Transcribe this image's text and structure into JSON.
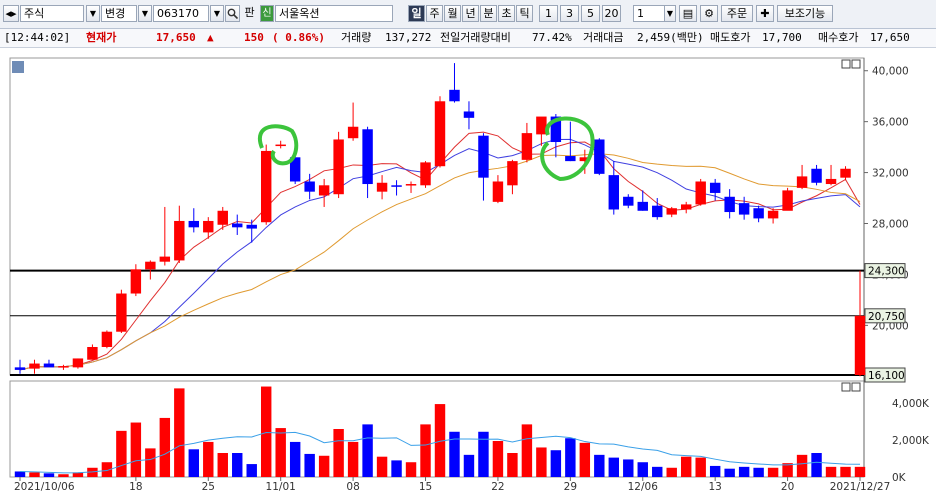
{
  "toolbar": {
    "market_select": "주식",
    "mode_select": "변경",
    "code_input": "063170",
    "pan_button": "판",
    "credit_badge": "신",
    "company_name": "서울옥션",
    "period_buttons": [
      "일",
      "주",
      "월",
      "년",
      "분",
      "초",
      "틱"
    ],
    "active_period": "일",
    "interval_buttons": [
      "1",
      "3",
      "5",
      "20"
    ],
    "interval_value": "1",
    "order_button": "주문",
    "aux_button": "보조기능"
  },
  "info_bar": {
    "time": "[12:44:02]",
    "price_label": "현재가",
    "price": "17,650",
    "change_arrow": "▲",
    "change": "150",
    "change_pct": "( 0.86%)",
    "volume_label": "거래량",
    "volume": "137,272",
    "prev_ratio_label": "전일거래량대비",
    "prev_ratio": "77.42%",
    "trade_value_label": "거래대금",
    "trade_value": "2,459(백만)",
    "ask_label": "매도호가",
    "ask": "17,700",
    "bid_label": "매수호가",
    "bid": "17,650"
  },
  "chart_data": {
    "type": "candlestick",
    "price_axis_ticks": [
      "40,000",
      "36,000",
      "32,000",
      "28,000",
      "24,000",
      "20,000"
    ],
    "volume_axis_ticks": [
      "4,000K",
      "2,000K",
      "0K"
    ],
    "date_axis_ticks": [
      "2021/10/06",
      "18",
      "25",
      "11/01",
      "08",
      "15",
      "22",
      "29",
      "12/06",
      "13",
      "20",
      "2021/12/27"
    ],
    "ylim": [
      16100,
      41000
    ],
    "horizontal_levels": [
      {
        "label": "24,300",
        "value": 24300
      },
      {
        "label": "20,750",
        "value": 20750
      },
      {
        "label": "16,100",
        "value": 16100
      }
    ],
    "candles": [
      {
        "o": 16700,
        "h": 17300,
        "l": 16200,
        "c": 16500,
        "v": 300
      },
      {
        "o": 16600,
        "h": 17300,
        "l": 16200,
        "c": 17000,
        "v": 250
      },
      {
        "o": 17000,
        "h": 17300,
        "l": 16900,
        "c": 16700,
        "v": 200
      },
      {
        "o": 16700,
        "h": 16900,
        "l": 16500,
        "c": 16800,
        "v": 150
      },
      {
        "o": 16700,
        "h": 17400,
        "l": 16600,
        "c": 17400,
        "v": 250
      },
      {
        "o": 17300,
        "h": 18500,
        "l": 17300,
        "c": 18300,
        "v": 500
      },
      {
        "o": 18300,
        "h": 19600,
        "l": 18200,
        "c": 19500,
        "v": 800
      },
      {
        "o": 19500,
        "h": 22800,
        "l": 19400,
        "c": 22500,
        "v": 2500
      },
      {
        "o": 22500,
        "h": 24800,
        "l": 22300,
        "c": 24400,
        "v": 2950
      },
      {
        "o": 24400,
        "h": 25100,
        "l": 23600,
        "c": 25000,
        "v": 1550
      },
      {
        "o": 25000,
        "h": 29300,
        "l": 24700,
        "c": 25400,
        "v": 3200
      },
      {
        "o": 25100,
        "h": 29400,
        "l": 24900,
        "c": 28200,
        "v": 4800
      },
      {
        "o": 28200,
        "h": 29200,
        "l": 27300,
        "c": 27700,
        "v": 1500
      },
      {
        "o": 27300,
        "h": 28500,
        "l": 26800,
        "c": 28200,
        "v": 1900
      },
      {
        "o": 27900,
        "h": 29300,
        "l": 27500,
        "c": 29000,
        "v": 1300
      },
      {
        "o": 28000,
        "h": 28700,
        "l": 27100,
        "c": 27700,
        "v": 1300
      },
      {
        "o": 27900,
        "h": 28300,
        "l": 26500,
        "c": 27600,
        "v": 700
      },
      {
        "o": 28100,
        "h": 34200,
        "l": 27900,
        "c": 33700,
        "v": 4900
      },
      {
        "o": 34100,
        "h": 34500,
        "l": 33900,
        "c": 34200,
        "v": 2650
      },
      {
        "o": 33200,
        "h": 33700,
        "l": 31100,
        "c": 31300,
        "v": 1900
      },
      {
        "o": 31300,
        "h": 31900,
        "l": 29900,
        "c": 30500,
        "v": 1250
      },
      {
        "o": 30200,
        "h": 31500,
        "l": 29300,
        "c": 31000,
        "v": 1150
      },
      {
        "o": 30300,
        "h": 35200,
        "l": 30000,
        "c": 34600,
        "v": 2600
      },
      {
        "o": 34700,
        "h": 37500,
        "l": 34500,
        "c": 35600,
        "v": 1900
      },
      {
        "o": 35400,
        "h": 35600,
        "l": 30000,
        "c": 31100,
        "v": 2850
      },
      {
        "o": 30500,
        "h": 31800,
        "l": 29900,
        "c": 31200,
        "v": 1100
      },
      {
        "o": 31000,
        "h": 31400,
        "l": 30200,
        "c": 30900,
        "v": 900
      },
      {
        "o": 31000,
        "h": 31300,
        "l": 30400,
        "c": 31100,
        "v": 800
      },
      {
        "o": 31000,
        "h": 32900,
        "l": 30800,
        "c": 32800,
        "v": 2850
      },
      {
        "o": 32500,
        "h": 38000,
        "l": 32400,
        "c": 37600,
        "v": 3950
      },
      {
        "o": 38500,
        "h": 40600,
        "l": 37500,
        "c": 37600,
        "v": 2450
      },
      {
        "o": 36800,
        "h": 37600,
        "l": 35400,
        "c": 36300,
        "v": 1200
      },
      {
        "o": 34900,
        "h": 35100,
        "l": 29800,
        "c": 31600,
        "v": 2450
      },
      {
        "o": 29700,
        "h": 31800,
        "l": 29600,
        "c": 31300,
        "v": 1950
      },
      {
        "o": 31000,
        "h": 33000,
        "l": 30300,
        "c": 32900,
        "v": 1300
      },
      {
        "o": 33000,
        "h": 35900,
        "l": 32800,
        "c": 35100,
        "v": 2850
      },
      {
        "o": 35000,
        "h": 36300,
        "l": 34100,
        "c": 36400,
        "v": 1600
      },
      {
        "o": 36400,
        "h": 36600,
        "l": 33200,
        "c": 34400,
        "v": 1450
      },
      {
        "o": 33300,
        "h": 36000,
        "l": 32900,
        "c": 32900,
        "v": 2100
      },
      {
        "o": 32900,
        "h": 33800,
        "l": 31900,
        "c": 33200,
        "v": 1850
      },
      {
        "o": 34600,
        "h": 34700,
        "l": 31800,
        "c": 31900,
        "v": 1200
      },
      {
        "o": 31800,
        "h": 32900,
        "l": 28700,
        "c": 29100,
        "v": 1050
      },
      {
        "o": 30100,
        "h": 30300,
        "l": 29200,
        "c": 29400,
        "v": 950
      },
      {
        "o": 29700,
        "h": 30600,
        "l": 29000,
        "c": 29000,
        "v": 800
      },
      {
        "o": 29400,
        "h": 30000,
        "l": 28300,
        "c": 28500,
        "v": 550
      },
      {
        "o": 28700,
        "h": 29300,
        "l": 28500,
        "c": 29200,
        "v": 500
      },
      {
        "o": 29100,
        "h": 29700,
        "l": 28800,
        "c": 29500,
        "v": 1100
      },
      {
        "o": 29500,
        "h": 31500,
        "l": 29400,
        "c": 31300,
        "v": 1050
      },
      {
        "o": 31200,
        "h": 31500,
        "l": 29800,
        "c": 30400,
        "v": 600
      },
      {
        "o": 30100,
        "h": 30700,
        "l": 28400,
        "c": 28900,
        "v": 450
      },
      {
        "o": 29600,
        "h": 30100,
        "l": 28300,
        "c": 28700,
        "v": 550
      },
      {
        "o": 29200,
        "h": 29400,
        "l": 28100,
        "c": 28400,
        "v": 500
      },
      {
        "o": 28400,
        "h": 29200,
        "l": 28000,
        "c": 29000,
        "v": 500
      },
      {
        "o": 29000,
        "h": 30800,
        "l": 29200,
        "c": 30600,
        "v": 750
      },
      {
        "o": 30800,
        "h": 32600,
        "l": 30700,
        "c": 31700,
        "v": 1200
      },
      {
        "o": 32300,
        "h": 32600,
        "l": 31000,
        "c": 31200,
        "v": 1300
      },
      {
        "o": 31100,
        "h": 32600,
        "l": 31000,
        "c": 31500,
        "v": 550
      },
      {
        "o": 31600,
        "h": 32500,
        "l": 31400,
        "c": 32300,
        "v": 550
      },
      {
        "o": 16100,
        "h": 24300,
        "l": 16000,
        "c": 20750,
        "v": 550
      }
    ]
  }
}
